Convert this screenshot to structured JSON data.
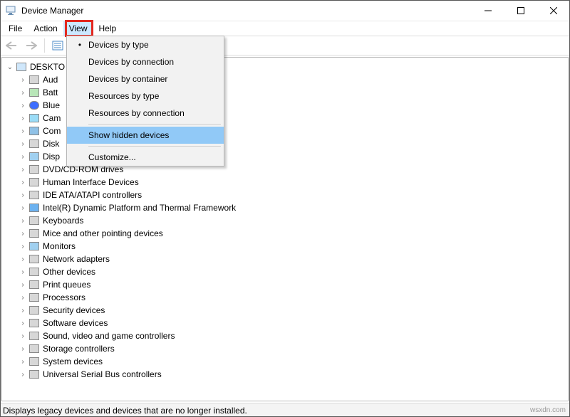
{
  "window": {
    "title": "Device Manager"
  },
  "menubar": {
    "file": "File",
    "action": "Action",
    "view": "View",
    "help": "Help"
  },
  "view_menu": {
    "devices_by_type": "Devices by type",
    "devices_by_connection": "Devices by connection",
    "devices_by_container": "Devices by container",
    "resources_by_type": "Resources by type",
    "resources_by_connection": "Resources by connection",
    "show_hidden_devices": "Show hidden devices",
    "customize": "Customize..."
  },
  "tree": {
    "root": "DESKTO",
    "items": [
      "Aud",
      "Batt",
      "Blue",
      "Cam",
      "Com",
      "Disk",
      "Disp",
      "DVD/CD-ROM drives",
      "Human Interface Devices",
      "IDE ATA/ATAPI controllers",
      "Intel(R) Dynamic Platform and Thermal Framework",
      "Keyboards",
      "Mice and other pointing devices",
      "Monitors",
      "Network adapters",
      "Other devices",
      "Print queues",
      "Processors",
      "Security devices",
      "Software devices",
      "Sound, video and game controllers",
      "Storage controllers",
      "System devices",
      "Universal Serial Bus controllers"
    ]
  },
  "statusbar": {
    "text": "Displays legacy devices and devices that are no longer installed."
  },
  "watermark": "wsxdn.com"
}
